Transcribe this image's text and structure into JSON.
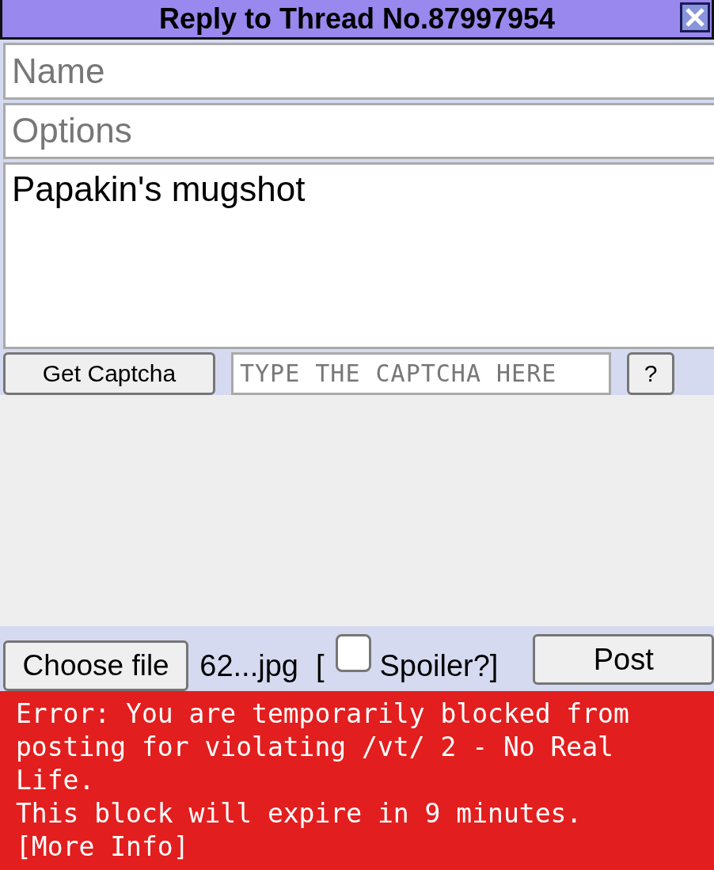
{
  "window": {
    "title": "Reply to Thread No.87997954"
  },
  "fields": {
    "name": {
      "placeholder": "Name"
    },
    "options": {
      "placeholder": "Options"
    },
    "comment": {
      "value": "Papakin's mugshot"
    }
  },
  "captcha": {
    "button": "Get Captcha",
    "placeholder": "TYPE THE CAPTCHA HERE",
    "help": "?"
  },
  "file": {
    "button": "Choose file",
    "filename": "62...jpg",
    "bracket_open": "[",
    "spoiler": {
      "label": "Spoiler?]",
      "checked": false
    },
    "post": "Post"
  },
  "error": {
    "lines": [
      "Error: You are temporarily blocked from posting for violating /vt/ 2 - No Real Life.",
      "This block will expire in 9 minutes."
    ],
    "link": "[More Info]"
  }
}
